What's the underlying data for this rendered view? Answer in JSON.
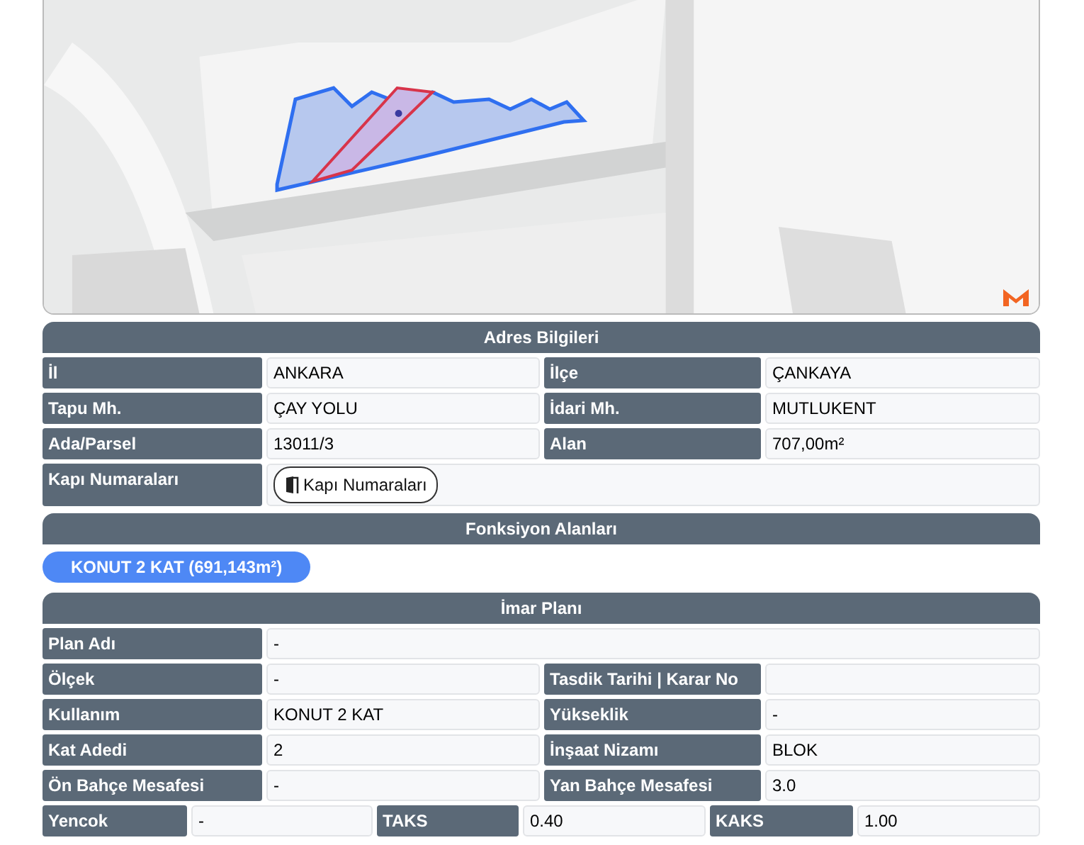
{
  "sections": [
    {
      "title": "Adres Bilgileri",
      "kind": "table",
      "rows": [
        [
          {
            "label": "İl",
            "value": "ANKARA"
          },
          {
            "label": "İlçe",
            "value": "ÇANKAYA"
          }
        ],
        [
          {
            "label": "Tapu Mh.",
            "value": "ÇAY YOLU"
          },
          {
            "label": "İdari Mh.",
            "value": "MUTLUKENT"
          }
        ],
        [
          {
            "label": "Ada/Parsel",
            "value": "13011/3"
          },
          {
            "label": "Alan",
            "value": "707,00m²"
          }
        ],
        [
          {
            "label": "Kapı Numaraları",
            "button": "Kapı Numaraları"
          }
        ]
      ]
    },
    {
      "title": "Fonksiyon Alanları",
      "kind": "pills",
      "items": [
        "KONUT 2 KAT (691,143m²)"
      ]
    },
    {
      "title": "İmar Planı",
      "kind": "table",
      "rows": [
        [
          {
            "label": "Plan Adı",
            "value": "-"
          }
        ],
        [
          {
            "label": "Ölçek",
            "value": "-"
          },
          {
            "label": "Tasdik Tarihi | Karar No"
          }
        ],
        [
          {
            "label": "Kullanım",
            "value": "KONUT 2 KAT"
          },
          {
            "label": "Yükseklik",
            "value": "-"
          }
        ],
        [
          {
            "label": "Kat Adedi",
            "value": "2"
          },
          {
            "label": "İnşaat Nizamı",
            "value": "BLOK"
          }
        ],
        [
          {
            "label": "Ön Bahçe Mesafesi",
            "value": "-"
          },
          {
            "label": "Yan Bahçe Mesafesi",
            "value": "3.0"
          }
        ],
        [
          {
            "label": "Yencok",
            "value": "-"
          },
          {
            "label": "TAKS",
            "value": "0.40"
          },
          {
            "label": "KAKS",
            "value": "1.00"
          }
        ]
      ]
    }
  ]
}
